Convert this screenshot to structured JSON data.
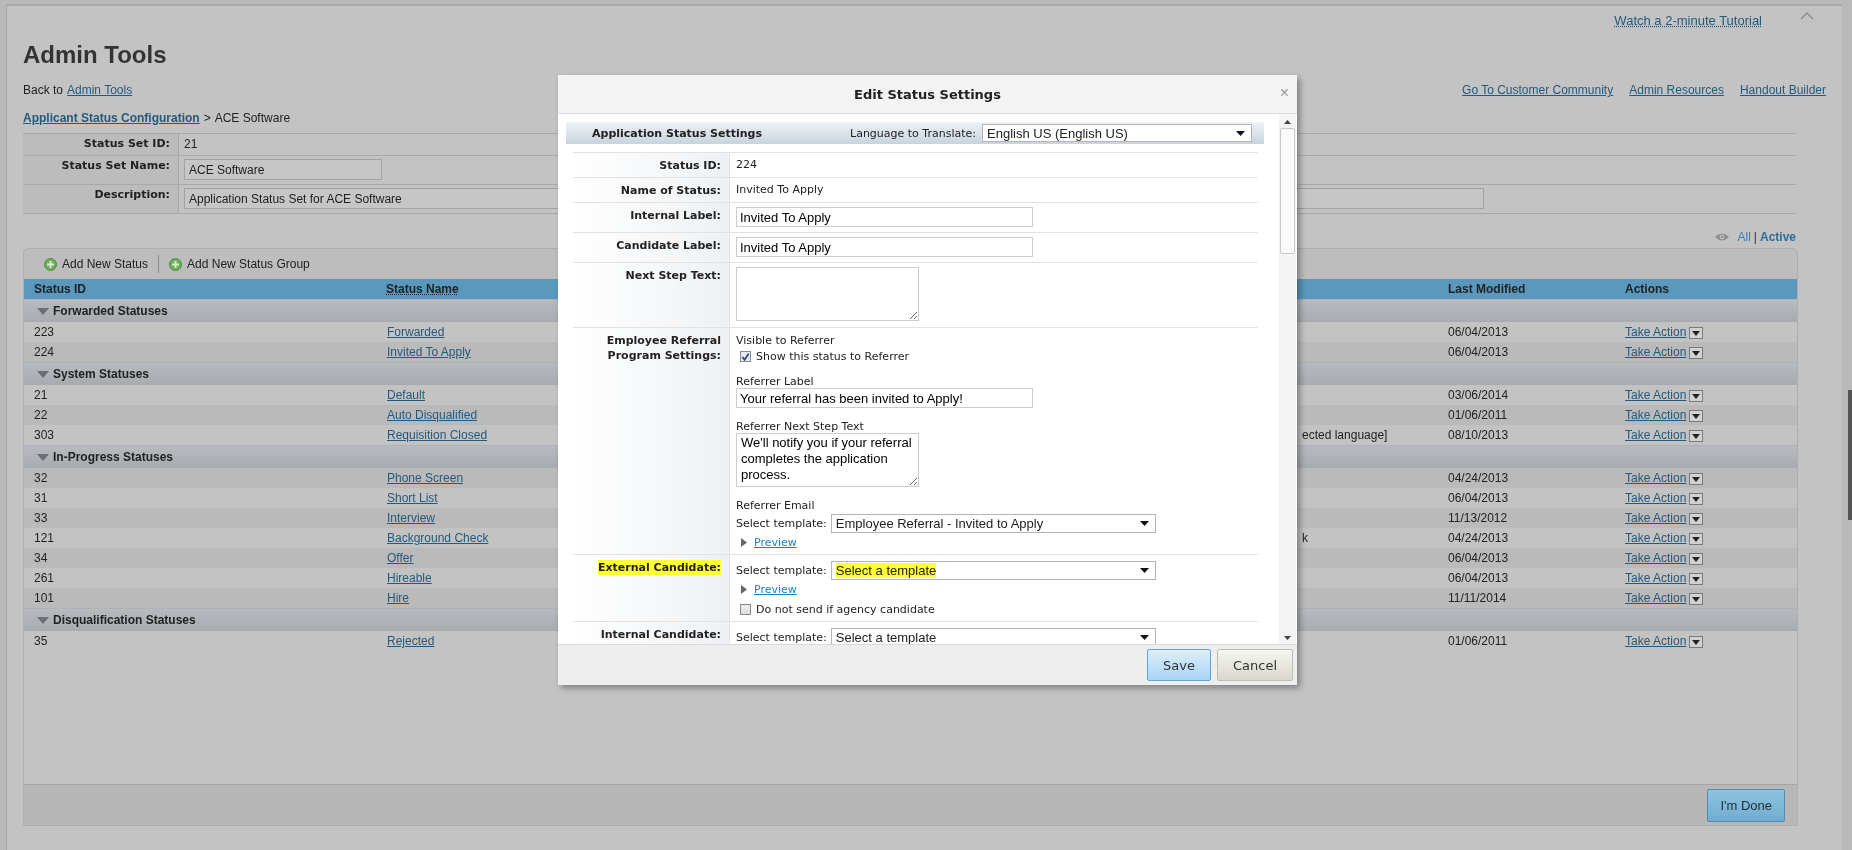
{
  "page": {
    "tutorial_link": "Watch a 2-minute Tutorial",
    "title": "Admin Tools",
    "back_text": "Back to",
    "back_link": "Admin Tools",
    "header_links": [
      "Go To Customer Community",
      "Admin Resources",
      "Handout Builder"
    ],
    "breadcrumb": {
      "link": "Applicant Status Configuration",
      "separator": ">",
      "current": "ACE Software"
    }
  },
  "status_set": [
    {
      "label": "Status Set ID:",
      "value": "21",
      "kind": "text"
    },
    {
      "label": "Status Set Name:",
      "value": "ACE Software",
      "kind": "input"
    },
    {
      "label": "Description:",
      "value": "Application Status Set for ACE Software",
      "kind": "wide-input"
    }
  ],
  "filter": {
    "separator": "|",
    "options": [
      {
        "label": "All",
        "selected": false
      },
      {
        "label": "Active",
        "selected": true
      }
    ]
  },
  "toolbar": [
    "Add New Status",
    "Add New Status Group"
  ],
  "table": {
    "columns": [
      "Status ID",
      "Status Name",
      "Last Modified",
      "Actions"
    ],
    "groups": [
      {
        "name": "Forwarded Statuses",
        "expanded": true,
        "rows": [
          {
            "id": "223",
            "name": "Forwarded",
            "last_modified": "06/04/2013",
            "action": "Take Action"
          },
          {
            "id": "224",
            "name": "Invited To Apply",
            "last_modified": "06/04/2013",
            "action": "Take Action"
          }
        ]
      },
      {
        "name": "System Statuses",
        "expanded": true,
        "rows": [
          {
            "id": "21",
            "name": "Default",
            "last_modified": "03/06/2014",
            "action": "Take Action"
          },
          {
            "id": "22",
            "name": "Auto Disqualified",
            "last_modified": "01/06/2011",
            "action": "Take Action"
          },
          {
            "id": "303",
            "name": "Requisition Closed",
            "column_3": "ected language]",
            "last_modified": "08/10/2013",
            "action": "Take Action"
          }
        ]
      },
      {
        "name": "In-Progress Statuses",
        "expanded": true,
        "rows": [
          {
            "id": "32",
            "name": "Phone Screen",
            "last_modified": "04/24/2013",
            "action": "Take Action"
          },
          {
            "id": "31",
            "name": "Short List",
            "last_modified": "06/04/2013",
            "action": "Take Action"
          },
          {
            "id": "33",
            "name": "Interview",
            "last_modified": "11/13/2012",
            "action": "Take Action"
          },
          {
            "id": "121",
            "name": "Background Check",
            "column_3": "k",
            "last_modified": "04/24/2013",
            "action": "Take Action"
          },
          {
            "id": "34",
            "name": "Offer",
            "last_modified": "06/04/2013",
            "action": "Take Action"
          },
          {
            "id": "261",
            "name": "Hireable",
            "last_modified": "06/04/2013",
            "action": "Take Action"
          },
          {
            "id": "101",
            "name": "Hire",
            "last_modified": "11/11/2014",
            "action": "Take Action"
          }
        ]
      },
      {
        "name": "Disqualification Statuses",
        "expanded": true,
        "rows": [
          {
            "id": "35",
            "name": "Rejected",
            "last_modified": "01/06/2011",
            "action": "Take Action"
          }
        ]
      }
    ]
  },
  "done_button": "I'm Done",
  "dialog": {
    "title": "Edit Status Settings",
    "close": "×",
    "section_title": "Application Status Settings",
    "language_label": "Language to Translate:",
    "language_value": "English US (English US)",
    "fields": [
      {
        "kind": "text",
        "label": "Status ID:",
        "value": "224"
      },
      {
        "kind": "text",
        "label": "Name of Status:",
        "value": "Invited To Apply"
      },
      {
        "kind": "input",
        "label": "Internal Label:",
        "value": "Invited To Apply"
      },
      {
        "kind": "input",
        "label": "Candidate Label:",
        "value": "Invited To Apply"
      },
      {
        "kind": "textarea",
        "label": "Next Step Text:"
      },
      {
        "kind": "referral",
        "label": "Employee Referral Program Settings:",
        "visible_heading": "Visible to Referrer",
        "checkbox": {
          "label": "Show this status to Referrer",
          "checked": true
        },
        "referrer_label": {
          "label": "Referrer Label",
          "value": "Your referral has been invited to Apply!"
        },
        "next_step": {
          "label": "Referrer Next Step Text",
          "value": "We'll notify you if your referral completes the application process."
        },
        "email": {
          "label": "Referrer Email",
          "select_label": "Select template:",
          "value": "Employee Referral - Invited to Apply",
          "preview": "Preview"
        }
      },
      {
        "kind": "template",
        "label": "External Candidate:",
        "highlighted": true,
        "select_label": "Select template:",
        "value": "Select a template",
        "preview": "Preview",
        "checkbox": {
          "label": "Do not send if agency candidate",
          "checked": false
        }
      },
      {
        "kind": "template",
        "label": "Internal Candidate:",
        "highlighted": false,
        "select_label": "Select template:",
        "value": "Select a template"
      }
    ],
    "buttons": [
      {
        "label": "Save",
        "primary": true
      },
      {
        "label": "Cancel",
        "primary": false
      }
    ]
  }
}
